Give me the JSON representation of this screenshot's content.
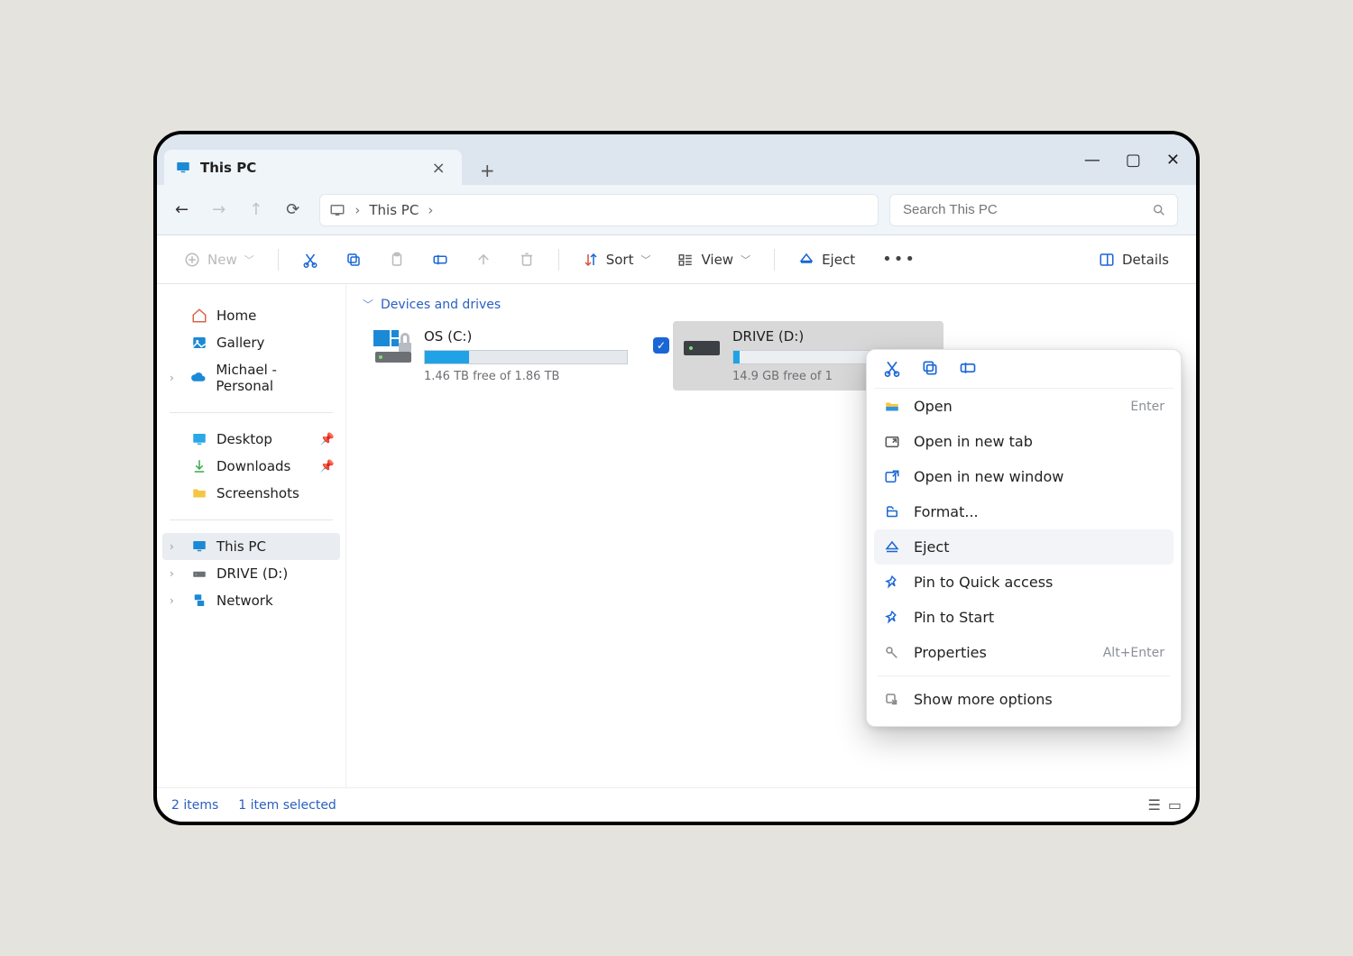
{
  "titlebar": {
    "tab_title": "This PC",
    "new_tab": "+",
    "close": "×",
    "min": "—",
    "max": "▢",
    "x": "✕"
  },
  "nav": {
    "breadcrumb_root": "This PC",
    "search_placeholder": "Search This PC"
  },
  "toolbar": {
    "new": "New",
    "sort": "Sort",
    "view": "View",
    "eject": "Eject",
    "details": "Details"
  },
  "sidebar": {
    "home": "Home",
    "gallery": "Gallery",
    "user": "Michael - Personal",
    "desktop": "Desktop",
    "downloads": "Downloads",
    "screenshots": "Screenshots",
    "thispc": "This PC",
    "drived": "DRIVE (D:)",
    "network": "Network"
  },
  "main": {
    "group_title": "Devices and drives",
    "drives": [
      {
        "name": "OS (C:)",
        "subtitle": "1.46 TB free of 1.86 TB",
        "percent_used": 22
      },
      {
        "name": "DRIVE (D:)",
        "subtitle": "14.9 GB free of 1",
        "percent_used": 3
      }
    ]
  },
  "context": {
    "open": "Open",
    "open_shortcut": "Enter",
    "open_tab": "Open in new tab",
    "open_window": "Open in new window",
    "format": "Format...",
    "eject": "Eject",
    "pin_quick": "Pin to Quick access",
    "pin_start": "Pin to Start",
    "properties": "Properties",
    "properties_shortcut": "Alt+Enter",
    "show_more": "Show more options"
  },
  "status": {
    "count": "2 items",
    "selected": "1 item selected"
  }
}
